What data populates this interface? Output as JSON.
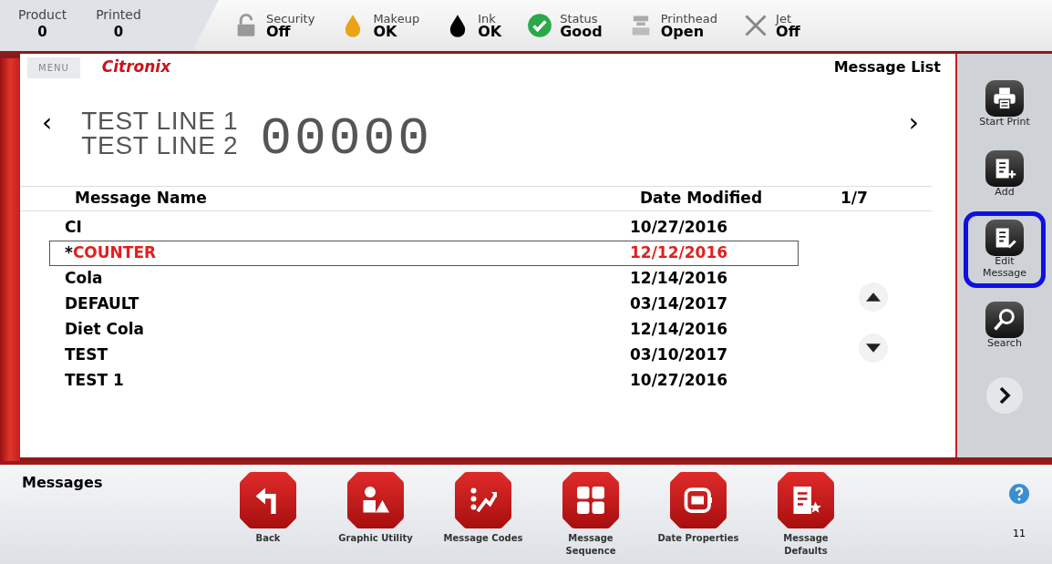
{
  "status_bar": {
    "counters": [
      {
        "label": "Product",
        "value": "0"
      },
      {
        "label": "Printed",
        "value": "0"
      }
    ],
    "items": [
      {
        "kind": "lock",
        "label": "Security",
        "value": "Off"
      },
      {
        "kind": "drop",
        "color": "#e8a317",
        "label": "Makeup",
        "value": "OK"
      },
      {
        "kind": "drop",
        "color": "#000000",
        "label": "Ink",
        "value": "OK"
      },
      {
        "kind": "check",
        "label": "Status",
        "value": "Good"
      },
      {
        "kind": "printhead",
        "label": "Printhead",
        "value": "Open"
      },
      {
        "kind": "cross",
        "label": "Jet",
        "value": "Off"
      }
    ]
  },
  "header": {
    "menu": "MENU",
    "logo": "Citronix",
    "title": "Message List"
  },
  "preview": {
    "prev": "‹",
    "next": "›",
    "lines": [
      "TEST LINE 1",
      "TEST LINE 2"
    ],
    "counter": "00000"
  },
  "table": {
    "columns": [
      "Message Name",
      "Date Modified"
    ],
    "page": "1/7",
    "rows": [
      {
        "flag": "",
        "name": "CI",
        "date": "10/27/2016",
        "selected": false
      },
      {
        "flag": "*",
        "name": "COUNTER",
        "date": "12/12/2016",
        "selected": true
      },
      {
        "flag": "",
        "name": "Cola",
        "date": "12/14/2016",
        "selected": false
      },
      {
        "flag": "",
        "name": "DEFAULT",
        "date": "03/14/2017",
        "selected": false
      },
      {
        "flag": "",
        "name": "Diet Cola",
        "date": "12/14/2016",
        "selected": false
      },
      {
        "flag": "",
        "name": "TEST",
        "date": "03/10/2017",
        "selected": false
      },
      {
        "flag": "",
        "name": "TEST 1",
        "date": "10/27/2016",
        "selected": false
      }
    ]
  },
  "sidebar": [
    {
      "kind": "print",
      "label": "Start Print",
      "highlighted": false
    },
    {
      "kind": "add",
      "label": "Add",
      "highlighted": false
    },
    {
      "kind": "edit",
      "label": "Edit Message",
      "highlighted": true
    },
    {
      "kind": "search",
      "label": "Search",
      "highlighted": false
    }
  ],
  "footer": {
    "title": "Messages",
    "page": "11",
    "buttons": [
      {
        "kind": "back",
        "label": "Back"
      },
      {
        "kind": "graphic",
        "label": "Graphic Utility"
      },
      {
        "kind": "codes",
        "label": "Message Codes"
      },
      {
        "kind": "sequence",
        "label": "Message Sequence"
      },
      {
        "kind": "date",
        "label": "Date Properties"
      },
      {
        "kind": "defaults",
        "label": "Message Defaults"
      }
    ]
  }
}
